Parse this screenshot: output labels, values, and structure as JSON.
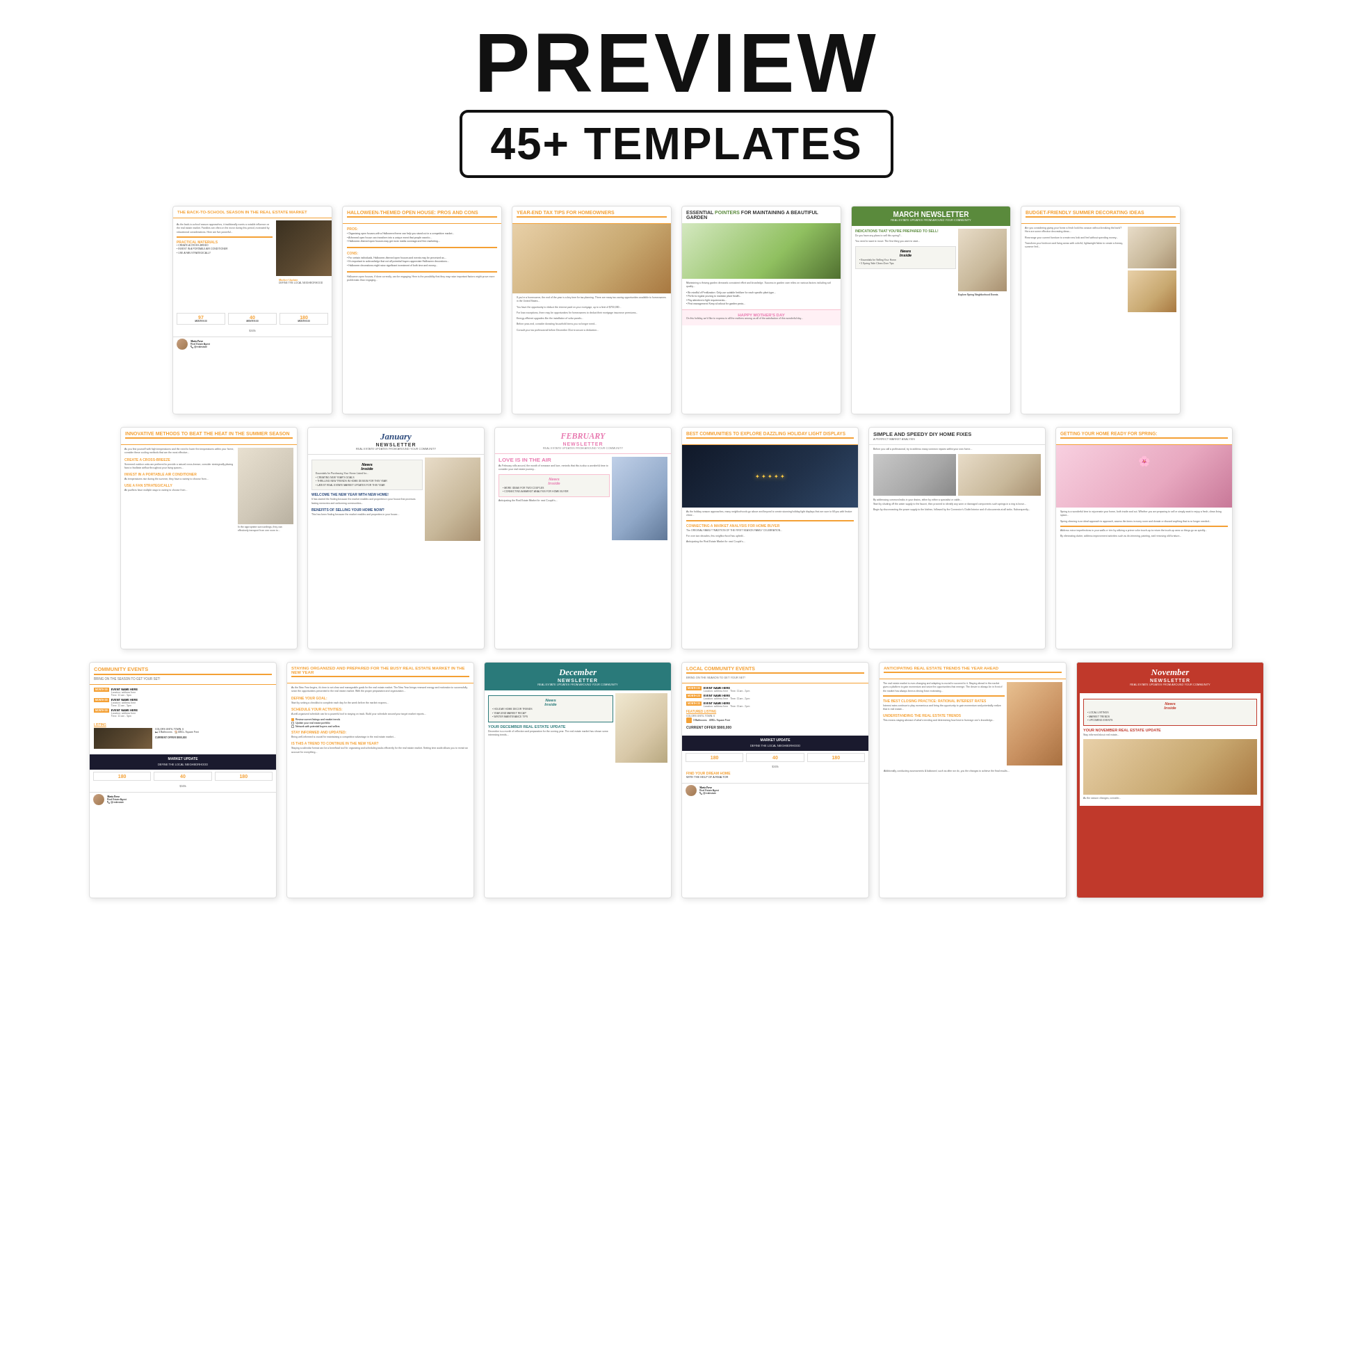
{
  "header": {
    "preview_label": "PREVIEW",
    "templates_label": "45+ TEMPLATES"
  },
  "row1": [
    {
      "id": "back-to-school",
      "accent": "orange",
      "title": "THE BACK-TO-SCHOOL SEASON IN THE REAL ESTATE MARKET",
      "type": "article",
      "image_type": "dark-room",
      "has_market_update": true
    },
    {
      "id": "halloween",
      "accent": "orange",
      "title": "HALLOWEEN-THEMED OPEN HOUSE: PROS AND CONS",
      "type": "pros-cons",
      "has_pros": true,
      "has_cons": true
    },
    {
      "id": "year-end-tax",
      "accent": "orange",
      "title": "YEAR-END TAX TIPS FOR HOMEOWNERS",
      "type": "article",
      "image_type": "warm-room"
    },
    {
      "id": "garden",
      "accent": "none",
      "title": "ESSENTIAL POINTERS FOR MAINTAINING A BEAUTIFUL GARDEN",
      "type": "article-image",
      "image_type": "garden-bg",
      "has_mothers_day": true
    },
    {
      "id": "march",
      "accent": "green",
      "title": "MARCH NEWSLETTER",
      "subtitle": "REAL ESTATE UPDATES FROM AROUND YOUR COMMUNITY",
      "type": "newsletter",
      "has_news_inside": true,
      "image_type": "room-bright"
    },
    {
      "id": "budget",
      "accent": "orange",
      "title": "BUDGET-FRIENDLY SUMMER DECORATING IDEAS",
      "type": "article",
      "image_type": "room-bright"
    }
  ],
  "row2": [
    {
      "id": "summer-heat",
      "accent": "orange",
      "title": "INNOVATIVE METHODS TO BEAT THE HEAT IN THE SUMMER SEASON",
      "type": "article",
      "image_type": "light-living",
      "has_tips": true
    },
    {
      "id": "january",
      "accent": "blue",
      "title": "January",
      "subtitle": "NEWSLETTER",
      "type": "newsletter-script",
      "news_items": [
        "CREATING NEW YEAR'S GOALS",
        "THRILLING NEW TRENDS IN HOME DESIGN FOR THIS YEAR",
        "LATEST REAL ESTATE MARKET UPDATES FOR THIS YEAR"
      ],
      "has_welcome": true,
      "has_benefits": true,
      "image_type": "room-bright"
    },
    {
      "id": "february",
      "accent": "pink",
      "title": "FEBRUARY",
      "subtitle": "NEWSLETTER",
      "type": "newsletter-script",
      "news_items": [
        "LOVE IS IN THE AIR"
      ],
      "has_welcome": true,
      "image_type": "blue-room"
    },
    {
      "id": "holiday-lights",
      "accent": "orange",
      "title": "BEST COMMUNITIES TO EXPLORE DAZZLING HOLIDAY LIGHT DISPLAYS",
      "type": "article",
      "image_type": "night-city",
      "has_market_analysis": true
    },
    {
      "id": "simple-fixes",
      "accent": "none",
      "title": "SIMPLE AND SPEEDY DIY HOME FIXES",
      "type": "article-multi-image",
      "image_type": "gray-room"
    },
    {
      "id": "getting-ready",
      "accent": "orange",
      "title": "GETTING YOUR HOME READY FOR SPRING:",
      "type": "article",
      "image_type": "pink-bg"
    }
  ],
  "row3": [
    {
      "id": "community-events",
      "accent": "orange",
      "title": "COMMUNITY EVENTS",
      "type": "events",
      "months": [
        "MONTH 00",
        "MONTH 00",
        "MONTH 00"
      ],
      "has_market_update": true
    },
    {
      "id": "staying-organized",
      "accent": "orange",
      "title": "STAYING ORGANIZED AND PREPARED FOR THE BUSY REAL ESTATE MARKET IN THE NEW YEAR",
      "type": "article",
      "has_checklist": true
    },
    {
      "id": "december",
      "accent": "teal",
      "title": "December",
      "subtitle": "NEWSLETTER",
      "type": "newsletter-script",
      "news_items": [
        "HOLIDAY HOME DECOR TRENDS",
        "YEAR-END MARKET RECAP",
        "WINTER MAINTENANCE TIPS"
      ],
      "has_your_december": true,
      "image_type": "bright-kitchen"
    },
    {
      "id": "local-events",
      "accent": "orange",
      "title": "LOCAL COMMUNITY EVENTS",
      "type": "events",
      "months": [
        "MONTH 00",
        "MONTH 20",
        "MONTH 30"
      ],
      "has_featured_listing": true,
      "has_market_update": true,
      "has_find_dream": true
    },
    {
      "id": "anticipating-trends",
      "accent": "orange",
      "title": "ANTICIPATING REAL ESTATE TRENDS THE YEAR AHEAD",
      "type": "article",
      "has_best_closing": true,
      "has_understanding": true,
      "image_type": "orange-room"
    },
    {
      "id": "november",
      "accent": "rust",
      "title": "November",
      "subtitle": "NEWSLETTER",
      "type": "newsletter-script",
      "news_items": [
        "LOCAL LISTINGS",
        "MARKET TRENDS",
        "UPCOMING EVENTS"
      ],
      "has_your_november": true,
      "image_type": "warm-room"
    }
  ]
}
